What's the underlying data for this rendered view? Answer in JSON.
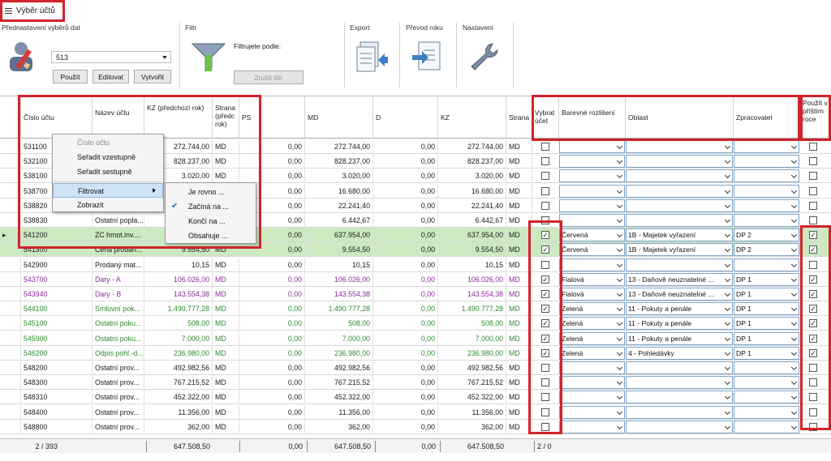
{
  "title": "Výběr účtů",
  "ribbon": {
    "preset_group": "Přednastavení výběrů dat",
    "preset_value": "513",
    "btn_use": "Použít",
    "btn_edit": "Editovat",
    "btn_create": "Vytvořit",
    "filter_group": "Filtr",
    "filter_by": "Filtrujete podle:",
    "btn_cancel_filter": "Zrušit filtr",
    "export": "Export",
    "year_transfer": "Převod roku",
    "settings": "Nastavení"
  },
  "columns": {
    "cislo": "Číslo účtu",
    "nazev": "Název účtu",
    "kz_prev": "KZ (předchozí rok)",
    "strana_prev": "Strana (předc rok)",
    "ps": "PS",
    "md": "MD",
    "d": "D",
    "kz": "KZ",
    "strana": "Strana",
    "vybrat": "Vybrat účet",
    "barevne": "Barevné rozlišení",
    "oblast": "Oblast",
    "zpracovatel": "Zpracovatel",
    "pouzit": "Použít v příštím roce"
  },
  "context_menu": {
    "items": [
      "Číslo účtu",
      "Seřadit vzestupně",
      "Seřadit sestupně",
      "Filtrovat",
      "Zobrazit"
    ],
    "submenu": [
      "Je rovno ...",
      "Začíná na ...",
      "Končí na ...",
      "Obsahuje ..."
    ]
  },
  "colors": {
    "accent_red": "#d1232a",
    "green_row": "#cde9c2",
    "purple_text": "#8a2a9a",
    "green_text": "#2e8b2e"
  },
  "rows": [
    {
      "cislo": "531100",
      "nazev": "",
      "kz_prev": "272.744,00",
      "strana_prev": "MD",
      "ps": "0,00",
      "md": "272.744,00",
      "d": "0,00",
      "kz": "272.744,00",
      "strana": "MD",
      "vybrat": false,
      "barevne": "",
      "oblast": "",
      "zprac": "",
      "pouzit": false
    },
    {
      "cislo": "532100",
      "nazev": "",
      "kz_prev": "828.237,00",
      "strana_prev": "MD",
      "ps": "0,00",
      "md": "828.237,00",
      "d": "0,00",
      "kz": "828.237,00",
      "strana": "MD",
      "vybrat": false,
      "barevne": "",
      "oblast": "",
      "zprac": "",
      "pouzit": false
    },
    {
      "cislo": "538100",
      "nazev": "",
      "kz_prev": "3.020,00",
      "strana_prev": "MD",
      "ps": "0,00",
      "md": "3.020,00",
      "d": "0,00",
      "kz": "3.020,00",
      "strana": "MD",
      "vybrat": false,
      "barevne": "",
      "oblast": "",
      "zprac": "",
      "pouzit": false
    },
    {
      "cislo": "538700",
      "nazev": "",
      "kz_prev": "",
      "strana_prev": "",
      "ps": "0,00",
      "md": "16.680,00",
      "d": "0,00",
      "kz": "16.680,00",
      "strana": "MD",
      "vybrat": false,
      "barevne": "",
      "oblast": "",
      "zprac": "",
      "pouzit": false
    },
    {
      "cislo": "538820",
      "nazev": "",
      "kz_prev": "",
      "strana_prev": "",
      "ps": "0,00",
      "md": "22.241,40",
      "d": "0,00",
      "kz": "22.241,40",
      "strana": "MD",
      "vybrat": false,
      "barevne": "",
      "oblast": "",
      "zprac": "",
      "pouzit": false
    },
    {
      "cislo": "538830",
      "nazev": "Ostatní popla...",
      "kz_prev": "",
      "strana_prev": "",
      "ps": "0,00",
      "md": "6.442,67",
      "d": "0,00",
      "kz": "6.442,67",
      "strana": "MD",
      "vybrat": false,
      "barevne": "",
      "oblast": "",
      "zprac": "",
      "pouzit": false
    },
    {
      "cislo": "541200",
      "nazev": "ZC hmot.inv....",
      "kz_prev": "",
      "strana_prev": "",
      "ps": "0,00",
      "md": "637.954,00",
      "d": "0,00",
      "kz": "637.954,00",
      "strana": "MD",
      "vybrat": true,
      "barevne": "Červená",
      "oblast": "1B - Majetek vyřazení",
      "zprac": "DP 2",
      "pouzit": true,
      "style": "green",
      "arrow": true
    },
    {
      "cislo": "541300",
      "nazev": "Cena prodan...",
      "kz_prev": "9.554,50",
      "strana_prev": "MD",
      "ps": "0,00",
      "md": "9.554,50",
      "d": "0,00",
      "kz": "9.554,50",
      "strana": "MD",
      "vybrat": true,
      "barevne": "Červená",
      "oblast": "1B - Majetek vyřazení",
      "zprac": "DP 2",
      "pouzit": true,
      "style": "green"
    },
    {
      "cislo": "542900",
      "nazev": "Prodaný mat...",
      "kz_prev": "10,15",
      "strana_prev": "MD",
      "ps": "0,00",
      "md": "10,15",
      "d": "0,00",
      "kz": "10,15",
      "strana": "MD",
      "vybrat": false,
      "barevne": "",
      "oblast": "",
      "zprac": "",
      "pouzit": false
    },
    {
      "cislo": "543700",
      "nazev": "Dary - A",
      "kz_prev": "106.026,00",
      "strana_prev": "MD",
      "ps": "0,00",
      "md": "106.026,00",
      "d": "0,00",
      "kz": "106.026,00",
      "strana": "MD",
      "vybrat": true,
      "barevne": "Fialová",
      "oblast": "13 - Daňově neuznatelné ...",
      "zprac": "DP 1",
      "pouzit": true,
      "style": "purple"
    },
    {
      "cislo": "543940",
      "nazev": "Dary - B",
      "kz_prev": "143.554,38",
      "strana_prev": "MD",
      "ps": "0,00",
      "md": "143.554,38",
      "d": "0,00",
      "kz": "143.554,38",
      "strana": "MD",
      "vybrat": true,
      "barevne": "Fialová",
      "oblast": "13 - Daňově neuznatelné ...",
      "zprac": "DP 1",
      "pouzit": true,
      "style": "purple"
    },
    {
      "cislo": "544100",
      "nazev": "Smluvní pok...",
      "kz_prev": "1.490.777,28",
      "strana_prev": "MD",
      "ps": "0,00",
      "md": "1.490.777,28",
      "d": "0,00",
      "kz": "1.490.777,28",
      "strana": "MD",
      "vybrat": true,
      "barevne": "Zelená",
      "oblast": "11 - Pokuty a penále",
      "zprac": "DP 1",
      "pouzit": true,
      "style": "greentext"
    },
    {
      "cislo": "545100",
      "nazev": "Ostatní poku...",
      "kz_prev": "508,00",
      "strana_prev": "MD",
      "ps": "0,00",
      "md": "508,00",
      "d": "0,00",
      "kz": "508,00",
      "strana": "MD",
      "vybrat": true,
      "barevne": "Zelená",
      "oblast": "11 - Pokuty a penále",
      "zprac": "DP 1",
      "pouzit": true,
      "style": "greentext"
    },
    {
      "cislo": "545900",
      "nazev": "Ostatní poku...",
      "kz_prev": "7.000,00",
      "strana_prev": "MD",
      "ps": "0,00",
      "md": "7.000,00",
      "d": "0,00",
      "kz": "7.000,00",
      "strana": "MD",
      "vybrat": true,
      "barevne": "Zelená",
      "oblast": "11 - Pokuty a penále",
      "zprac": "DP 1",
      "pouzit": true,
      "style": "greentext"
    },
    {
      "cislo": "546200",
      "nazev": "Odpis pohl.-d...",
      "kz_prev": "236.980,00",
      "strana_prev": "MD",
      "ps": "0,00",
      "md": "236.980,00",
      "d": "0,00",
      "kz": "236.980,00",
      "strana": "MD",
      "vybrat": true,
      "barevne": "Zelená",
      "oblast": "4 - Pohledávky",
      "zprac": "DP 1",
      "pouzit": true,
      "style": "greentext"
    },
    {
      "cislo": "548200",
      "nazev": "Ostatní prov...",
      "kz_prev": "492.982,56",
      "strana_prev": "MD",
      "ps": "0,00",
      "md": "492.982,56",
      "d": "0,00",
      "kz": "492.982,56",
      "strana": "MD",
      "vybrat": false,
      "barevne": "",
      "oblast": "",
      "zprac": "",
      "pouzit": false
    },
    {
      "cislo": "548300",
      "nazev": "Ostatní prov...",
      "kz_prev": "767.215,52",
      "strana_prev": "MD",
      "ps": "0,00",
      "md": "767.215,52",
      "d": "0,00",
      "kz": "767.215,52",
      "strana": "MD",
      "vybrat": false,
      "barevne": "",
      "oblast": "",
      "zprac": "",
      "pouzit": false
    },
    {
      "cislo": "548310",
      "nazev": "Ostatní prov...",
      "kz_prev": "452.322,00",
      "strana_prev": "MD",
      "ps": "0,00",
      "md": "452.322,00",
      "d": "0,00",
      "kz": "452.322,00",
      "strana": "MD",
      "vybrat": false,
      "barevne": "",
      "oblast": "",
      "zprac": "",
      "pouzit": false
    },
    {
      "cislo": "548400",
      "nazev": "Ostatní prov...",
      "kz_prev": "11.356,00",
      "strana_prev": "MD",
      "ps": "0,00",
      "md": "11.356,00",
      "d": "0,00",
      "kz": "11.356,00",
      "strana": "MD",
      "vybrat": false,
      "barevne": "",
      "oblast": "",
      "zprac": "",
      "pouzit": false
    },
    {
      "cislo": "548800",
      "nazev": "Ostatní prov...",
      "kz_prev": "362,00",
      "strana_prev": "MD",
      "ps": "0,00",
      "md": "362,00",
      "d": "0,00",
      "kz": "362,00",
      "strana": "MD",
      "vybrat": false,
      "barevne": "",
      "oblast": "",
      "zprac": "",
      "pouzit": false
    }
  ],
  "footer": {
    "count": "2 / 393",
    "kz_prev_sum": "647.508,50",
    "ps_sum": "0,00",
    "md_sum": "647.508,50",
    "d_sum": "0,00",
    "kz_sum": "647.508,50",
    "selected": "2 / 0"
  }
}
